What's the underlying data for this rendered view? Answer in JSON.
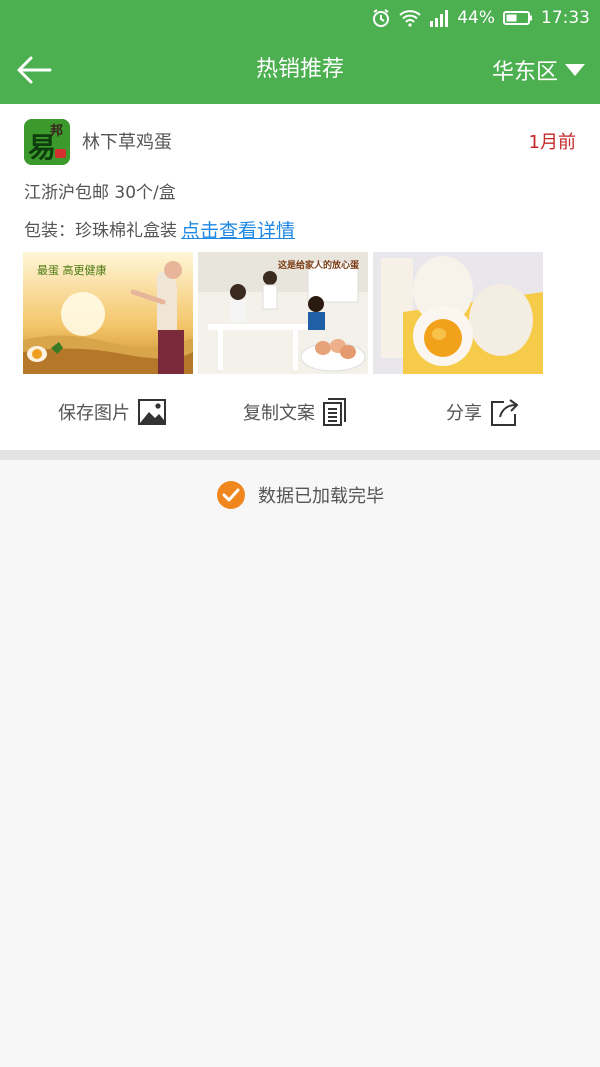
{
  "status_bar": {
    "battery": "44%",
    "time": "17:33",
    "icons": [
      "alarm-icon",
      "wifi-icon",
      "signal-icon",
      "battery-icon"
    ]
  },
  "app_bar": {
    "title": "热销推荐",
    "region": "华东区",
    "back_icon": "arrow-left-icon",
    "dropdown_icon": "triangle-down-icon",
    "color": "#4caf50"
  },
  "post": {
    "shop_name": "林下草鸡蛋",
    "time_ago": "1月前",
    "description": "江浙沪包邮 30个/盒",
    "packaging_label": "包装：珍珠棉礼盒装",
    "detail_link": "点击查看详情",
    "avatar_text": {
      "big": "易",
      "small": "邦"
    },
    "images": [
      {
        "name": "woman-field-image",
        "caption": "最蛋 高更健康"
      },
      {
        "name": "family-dining-image",
        "caption": "这是给家人的放心蛋"
      },
      {
        "name": "boiled-eggs-image",
        "caption": ""
      }
    ]
  },
  "actions": {
    "save_image": "保存图片",
    "copy_text": "复制文案",
    "share": "分享"
  },
  "footer": {
    "loaded_text": "数据已加载完毕",
    "check_color": "#f0871e"
  },
  "colors": {
    "link": "#1e88e5",
    "time": "#c62828"
  }
}
